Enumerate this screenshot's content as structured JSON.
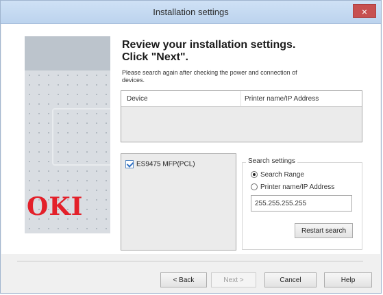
{
  "window": {
    "title": "Installation settings",
    "close_label": "×"
  },
  "brand": {
    "logo_text": "OKI",
    "logo_color": "#e3202a"
  },
  "instructions": {
    "heading_line1": "Review your installation settings.",
    "heading_line2": "Click \"Next\".",
    "subtext": "Please search again after checking the power and connection of devices."
  },
  "device_table": {
    "columns": [
      "Device",
      "Printer name/IP Address"
    ]
  },
  "device_list": {
    "items": [
      {
        "label": "ES9475 MFP(PCL)",
        "checked": true
      }
    ]
  },
  "search_settings": {
    "group_label": "Search settings",
    "option_range": "Search Range",
    "option_name": "Printer name/IP Address",
    "selected": "Search Range",
    "ip_value": "255.255.255.255",
    "restart_label": "Restart search"
  },
  "footer": {
    "back": "< Back",
    "next": "Next >",
    "cancel": "Cancel",
    "help": "Help"
  }
}
